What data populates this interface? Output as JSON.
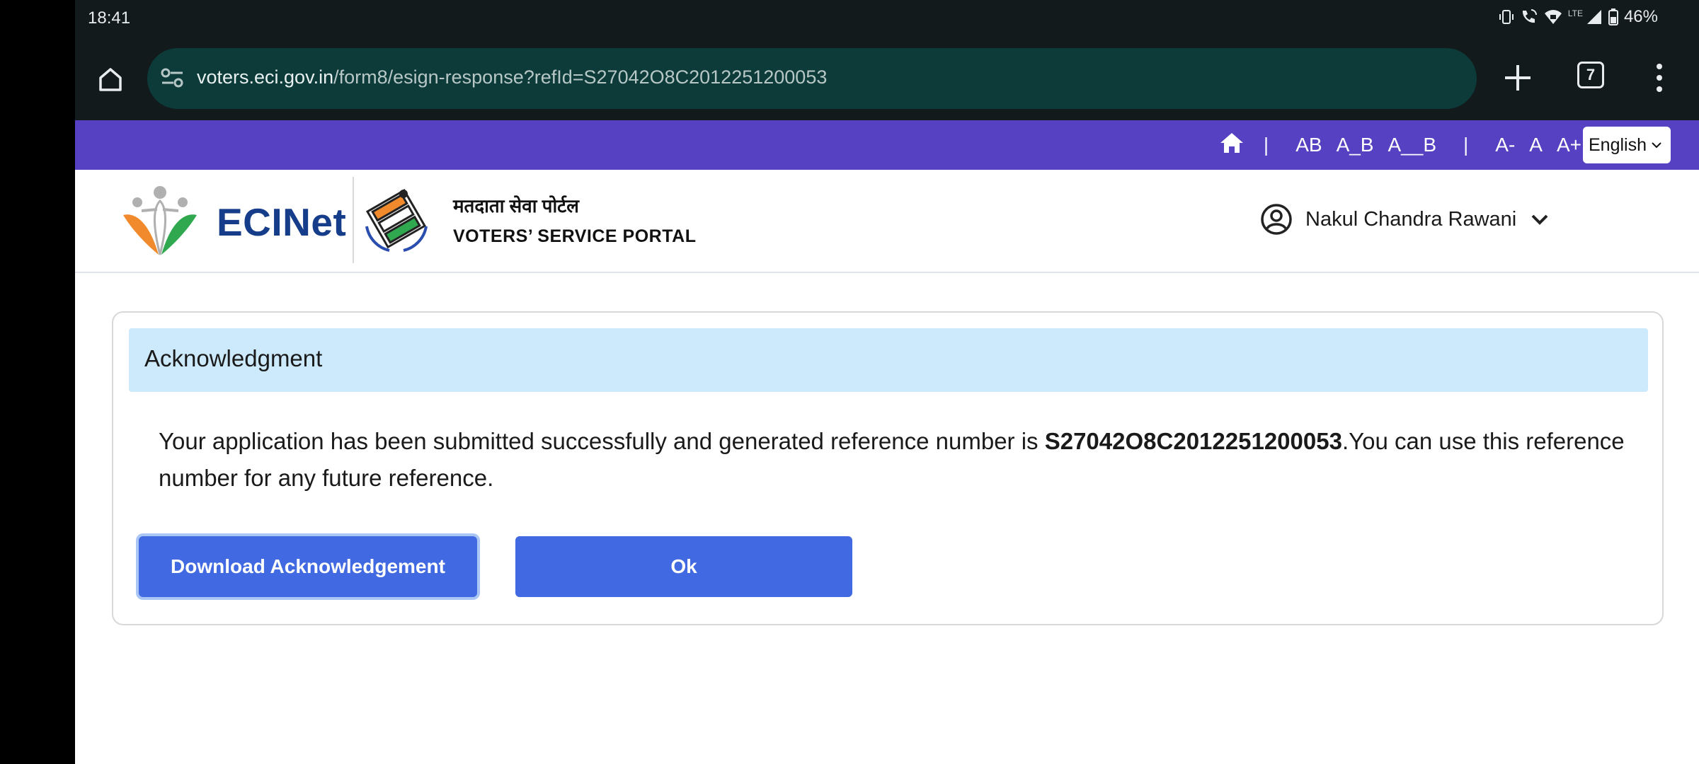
{
  "status_bar": {
    "time": "18:41",
    "lte": "LTE",
    "battery": "46%"
  },
  "browser": {
    "url_host": "voters.eci.gov.in",
    "url_path": "/form8/esign-response?refId=S27042O8C2012251200053",
    "tab_count": "7"
  },
  "util_bar": {
    "font_ab": "AB",
    "font_a_b": "A_B",
    "font_a__b": "A__B",
    "size_minus": "A-",
    "size_normal": "A",
    "size_plus": "A+",
    "language": "English"
  },
  "header": {
    "brand": "ECINet",
    "portal_hindi": "मतदाता सेवा पोर्टल",
    "portal_english": "VOTERS’ SERVICE PORTAL",
    "user_name": "Nakul Chandra Rawani"
  },
  "card": {
    "title": "Acknowledgment",
    "message_prefix": "Your application has been submitted successfully and generated reference number is ",
    "reference_number": "S27042O8C2012251200053",
    "message_suffix": ".You can use this reference number for any future reference.",
    "download_label": "Download Acknowledgement",
    "ok_label": "Ok"
  },
  "colors": {
    "util_bar": "#5541c2",
    "primary_button": "#4169e1",
    "card_header_bg": "#cdeafc",
    "brand_blue": "#163d8a"
  }
}
